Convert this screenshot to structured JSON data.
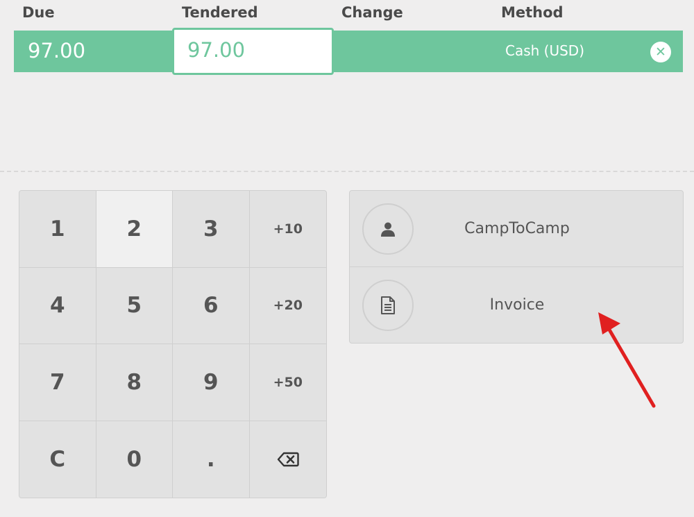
{
  "payment_table": {
    "headers": {
      "due": "Due",
      "tendered": "Tendered",
      "change": "Change",
      "method": "Method"
    },
    "line": {
      "due": "97.00",
      "tendered": "97.00",
      "change": "",
      "method": "Cash (USD)"
    }
  },
  "numpad": {
    "keys": [
      "1",
      "2",
      "3",
      "+10",
      "4",
      "5",
      "6",
      "+20",
      "7",
      "8",
      "9",
      "+50",
      "C",
      "0",
      ".",
      "backspace"
    ],
    "highlighted_key": "2"
  },
  "actions": {
    "customer_label": "CampToCamp",
    "invoice_label": "Invoice"
  },
  "icons": {
    "delete": "close-circle-icon",
    "customer": "user-icon",
    "invoice": "document-icon",
    "backspace": "backspace-icon"
  },
  "colors": {
    "accent": "#6ec69d",
    "annotation_arrow": "#e02020"
  }
}
